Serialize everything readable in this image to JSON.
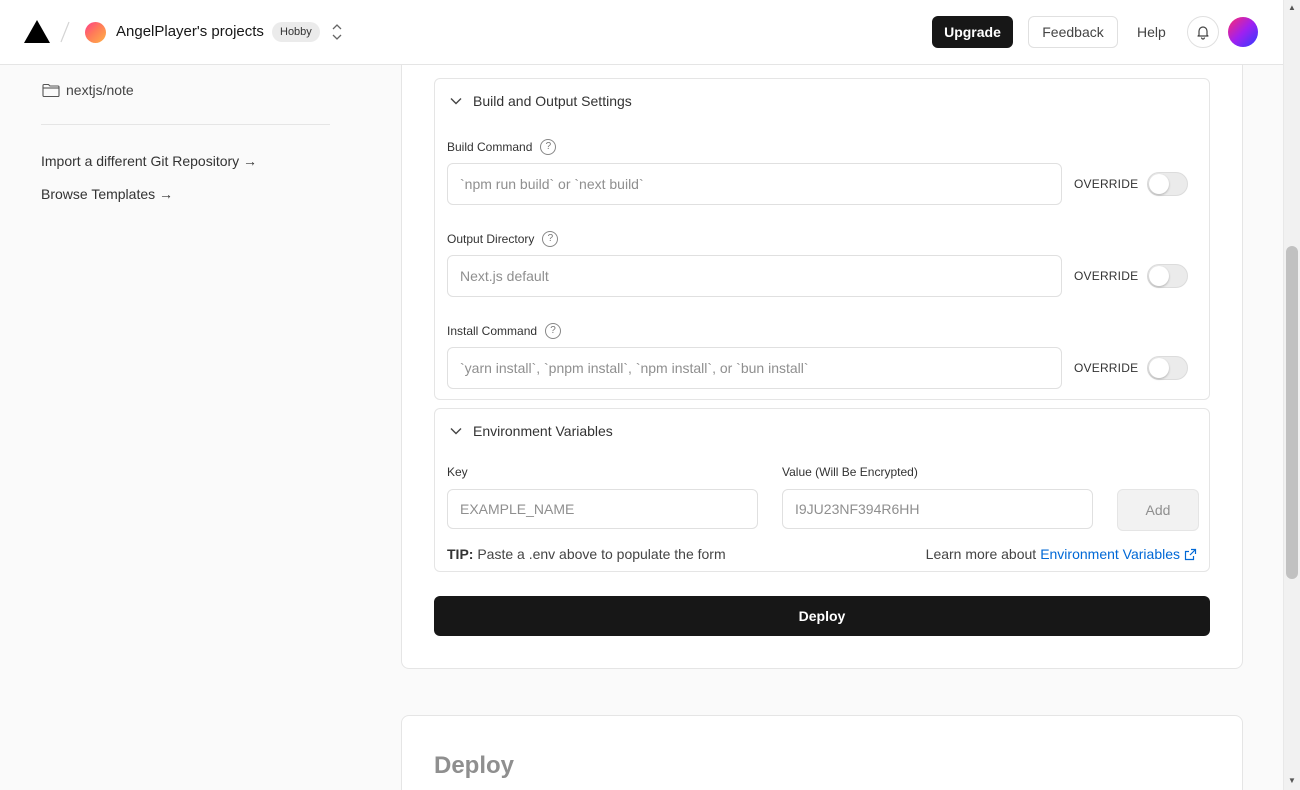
{
  "header": {
    "team_name": "AngelPlayer's projects",
    "plan_badge": "Hobby",
    "upgrade_label": "Upgrade",
    "feedback_label": "Feedback",
    "help_label": "Help"
  },
  "sidebar": {
    "repo_name": "nextjs/note",
    "import_link": "Import a different Git Repository →",
    "templates_link": "Browse Templates →"
  },
  "build_settings": {
    "title": "Build and Output Settings",
    "override_label": "OVERRIDE",
    "fields": [
      {
        "label": "Build Command",
        "placeholder": "`npm run build` or `next build`",
        "override": false
      },
      {
        "label": "Output Directory",
        "placeholder": "Next.js default",
        "override": false
      },
      {
        "label": "Install Command",
        "placeholder": "`yarn install`, `pnpm install`, `npm install`, or `bun install`",
        "override": false
      }
    ]
  },
  "env_vars": {
    "title": "Environment Variables",
    "key_label": "Key",
    "key_placeholder": "EXAMPLE_NAME",
    "value_label": "Value (Will Be Encrypted)",
    "value_placeholder": "I9JU23NF394R6HH",
    "add_label": "Add",
    "tip_prefix": "TIP:",
    "tip_text": " Paste a .env above to populate the form",
    "learn_more_text": "Learn more about",
    "learn_more_link": "Environment Variables"
  },
  "deploy_button": "Deploy",
  "deploy_section_title": "Deploy",
  "colors": {
    "primary": "#171717",
    "link": "#0068d6",
    "border": "#e5e5e5",
    "background": "#fafafa"
  }
}
